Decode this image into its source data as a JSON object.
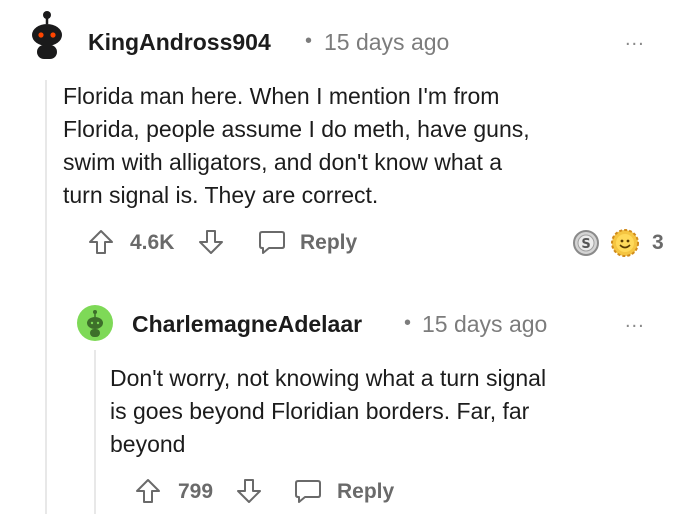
{
  "comments": [
    {
      "username": "KingAndross904",
      "separator": "•",
      "time": "15 days ago",
      "more": "...",
      "body_lines": [
        "Florida man here. When I mention I'm from",
        "Florida, people assume I do meth, have guns,",
        "swim with alligators, and don't know what a",
        "turn signal is. They are correct."
      ],
      "votes": "4.6K",
      "reply_label": "Reply",
      "award_count": "3",
      "avatar_color": "#1a1a1b"
    },
    {
      "username": "CharlemagneAdelaar",
      "separator": "•",
      "time": "15 days ago",
      "more": "...",
      "body_lines": [
        "Don't worry, not knowing what a turn signal",
        "is goes beyond Floridian borders. Far, far",
        "beyond"
      ],
      "votes": "799",
      "reply_label": "Reply",
      "avatar_color": "#7ed957"
    }
  ]
}
